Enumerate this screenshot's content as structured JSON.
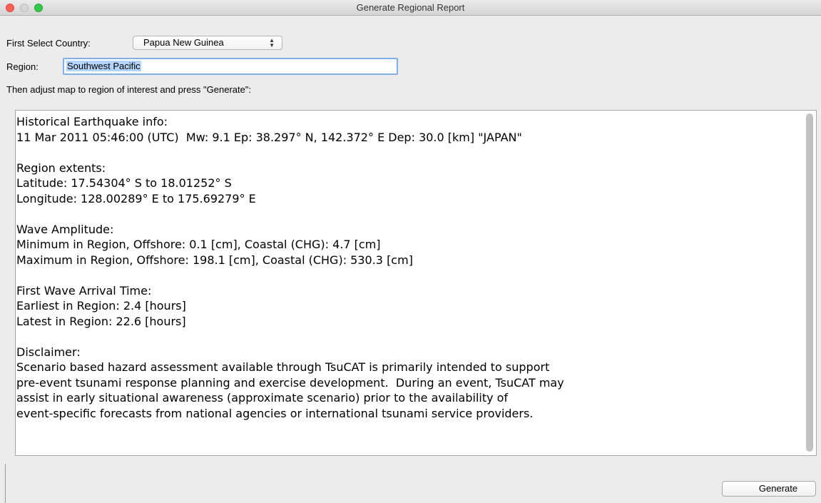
{
  "window": {
    "title": "Generate Regional Report"
  },
  "country": {
    "label": "First Select Country:",
    "value": "Papua New Guinea"
  },
  "region": {
    "label": "Region:",
    "value": "Southwest Pacific"
  },
  "instruction": "Then adjust map to region of interest and press \"Generate\":",
  "report": {
    "lines": [
      "Historical Earthquake info:",
      "11 Mar 2011 05:46:00 (UTC)  Mw: 9.1 Ep: 38.297° N, 142.372° E Dep: 30.0 [km] \"JAPAN\"",
      "",
      "Region extents:",
      "Latitude: 17.54304° S to 18.01252° S",
      "Longitude: 128.00289° E to 175.69279° E",
      "",
      "Wave Amplitude:",
      "Minimum in Region, Offshore: 0.1 [cm], Coastal (CHG): 4.7 [cm]",
      "Maximum in Region, Offshore: 198.1 [cm], Coastal (CHG): 530.3 [cm]",
      "",
      "First Wave Arrival Time:",
      "Earliest in Region: 2.4 [hours]",
      "Latest in Region: 22.6 [hours]",
      "",
      "Disclaimer:",
      "Scenario based hazard assessment available through TsuCAT is primarily intended to support",
      "pre-event tsunami response planning and exercise development.  During an event, TsuCAT may",
      "assist in early situational awareness (approximate scenario) prior to the availability of",
      "event-specific forecasts from national agencies or international tsunami service providers."
    ]
  },
  "buttons": {
    "generate": "Generate"
  }
}
